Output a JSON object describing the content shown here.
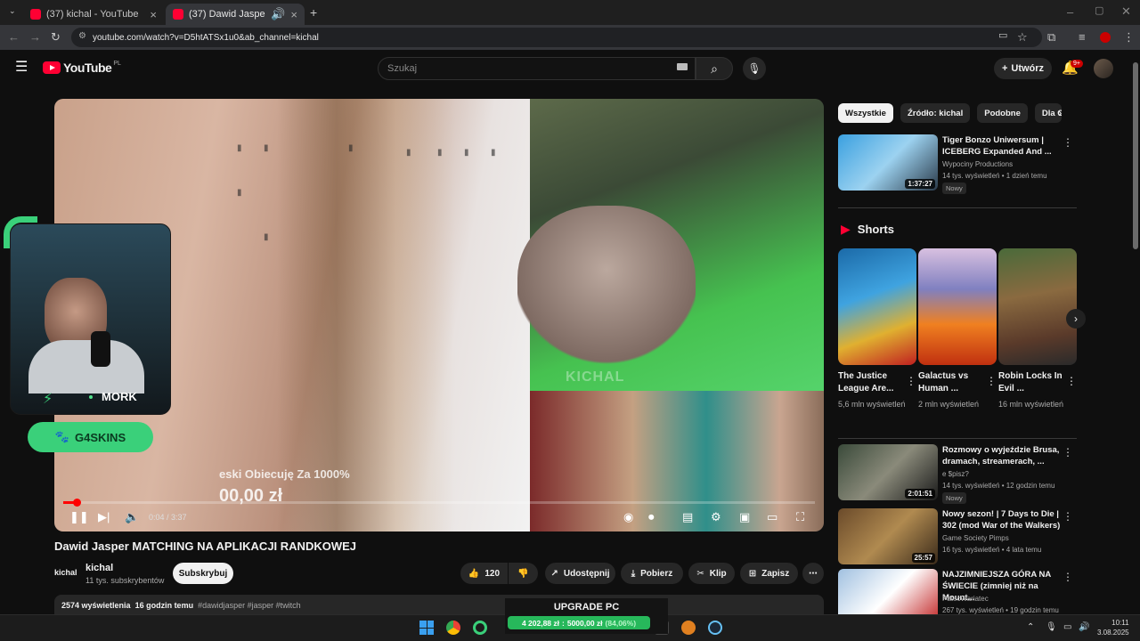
{
  "browser": {
    "tabs": [
      {
        "title": "(37) kichal - YouTube"
      },
      {
        "title": "(37) Dawid Jasper MATCHING"
      }
    ],
    "url": "youtube.com/watch?v=D5htATSx1u0&ab_channel=kichal"
  },
  "header": {
    "logo_text": "YouTube",
    "country": "PL",
    "search_placeholder": "Szukaj",
    "create_label": "Utwórz",
    "notifications": "9+"
  },
  "player": {
    "time": "0:04 / 3:37",
    "progress": 0.018,
    "overlay_text": "eski Obiecuję Za 1000%",
    "overlay_amount": "00,00 zł",
    "watermark": "KICHAL",
    "cam_name": "MORK",
    "sponsor": "G4SKINS"
  },
  "video": {
    "title": "Dawid Jasper MATCHING NA APLIKACJI RANDKOWEJ",
    "channel_name": "kichal",
    "channel_logo": "kichal",
    "subscribers": "11 tys. subskrybentów",
    "subscribe_label": "Subskrybuj",
    "likes": "120",
    "share_label": "Udostępnij",
    "download_label": "Pobierz",
    "clip_label": "Klip",
    "save_label": "Zapisz",
    "views": "2574 wyświetlenia",
    "age": "16 godzin temu",
    "tags": "#dawidjasper #jasper #twitch"
  },
  "sidebar": {
    "chips": [
      "Wszystkie",
      "Źródło: kichal",
      "Podobne",
      "Dla C"
    ],
    "recs": [
      {
        "title": "Tiger Bonzo Uniwersum | ICEBERG Expanded And ...",
        "channel": "Wypociny Productions",
        "meta": "14 tys. wyświetleń • 1 dzień temu",
        "badge": "Nowy",
        "duration": "1:37:27"
      },
      {
        "title": "Rozmowy o wyjeździe Brusa, dramach, streamerach, ...",
        "channel": "e $pisz?",
        "meta": "14 tys. wyświetleń • 12 godzin temu",
        "badge": "Nowy",
        "duration": "2:01:51"
      },
      {
        "title": "Nowy sezon! | 7 Days to Die | 302 (mod War of the Walkers)",
        "channel": "Game Society Pimps",
        "meta": "16 tys. wyświetleń • 4 lata temu",
        "duration": "25:57"
      },
      {
        "title": "NAJZIMNIEJSZA GÓRA NA ŚWIECIE (zimniej niż na Mount...",
        "channel": "PatecWariatec",
        "meta": "267 tys. wyświetleń • 19 godzin temu"
      }
    ],
    "shorts_title": "Shorts",
    "shorts": [
      {
        "title": "The Justice League Are...",
        "views": "5,6 mln wyświetleń"
      },
      {
        "title": "Galactus vs Human ...",
        "views": "2 mln wyświetleń"
      },
      {
        "title": "Robin Locks In Evil ...",
        "views": "16 mln wyświetleń"
      }
    ]
  },
  "taskbar": {
    "upgrade_label": "UPGRADE PC",
    "money_current": "4 202,88 zł",
    "money_sep": ":",
    "money_target": "5000,00 zł",
    "money_pct": "(84,06%)",
    "time": "10:11",
    "date": "3.08.2025"
  },
  "colors": {
    "accent": "#ff0033",
    "green": "#3ad07a"
  }
}
